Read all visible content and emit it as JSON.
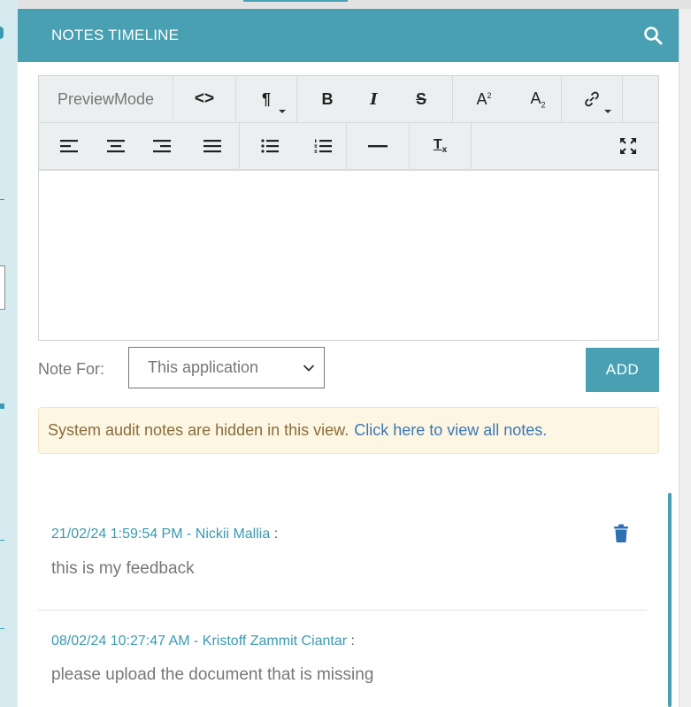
{
  "header": {
    "title": "NOTES TIMELINE"
  },
  "toolbar": {
    "preview_label": "PreviewMode",
    "code_glyph": "<>",
    "paragraph_glyph": "¶",
    "bold_glyph": "B",
    "italic_glyph": "I",
    "strike_glyph": "S",
    "superscript_glyph": "A",
    "superscript_mark": "2",
    "subscript_glyph": "A",
    "subscript_mark": "2",
    "clear_format_glyph": "T",
    "clear_format_mark": "x"
  },
  "note_for": {
    "label": "Note For:",
    "selected": "This application"
  },
  "add_button": {
    "label": "ADD"
  },
  "audit_notice": {
    "text": "System audit notes are hidden in this view.",
    "link": "Click here to view all notes."
  },
  "notes": [
    {
      "meta": "21/02/24 1:59:54 PM - Nickii Mallia",
      "separator": ":",
      "text": "this is my feedback"
    },
    {
      "meta": "08/02/24 10:27:47 AM - Kristoff Zammit Ciantar",
      "separator": ":",
      "text": "please upload the document that is missing"
    }
  ],
  "colors": {
    "primary": "#48a0b2",
    "link": "#3b78b5",
    "notice_bg": "#fdf6e3",
    "notice_text": "#8a6d3b",
    "delete_icon": "#2f6fb3"
  },
  "icons": {
    "search": "search-icon",
    "code": "code-icon",
    "paragraph": "paragraph-icon",
    "bold": "bold-icon",
    "italic": "italic-icon",
    "strike": "strikethrough-icon",
    "superscript": "superscript-icon",
    "subscript": "subscript-icon",
    "link": "link-icon",
    "align_left": "align-left-icon",
    "align_center": "align-center-icon",
    "align_right": "align-right-icon",
    "align_justify": "align-justify-icon",
    "bullet_list": "bullet-list-icon",
    "numbered_list": "numbered-list-icon",
    "horizontal_rule": "horizontal-rule-icon",
    "clear_format": "clear-format-icon",
    "fullscreen": "fullscreen-icon",
    "delete": "trash-icon",
    "chevron": "chevron-down-icon"
  }
}
